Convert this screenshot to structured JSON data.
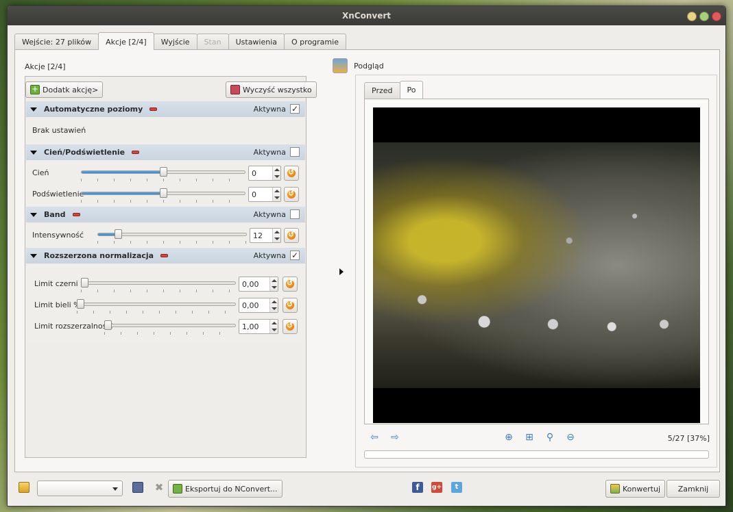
{
  "window": {
    "title": "XnConvert"
  },
  "tabs": [
    {
      "label": "Wejście: 27 plików",
      "state": "normal"
    },
    {
      "label": "Akcje [2/4]",
      "state": "active"
    },
    {
      "label": "Wyjście",
      "state": "normal"
    },
    {
      "label": "Stan",
      "state": "disabled"
    },
    {
      "label": "Ustawienia",
      "state": "normal"
    },
    {
      "label": "O programie",
      "state": "normal"
    }
  ],
  "actions_panel": {
    "title": "Akcje [2/4]",
    "add_button": "Dodatk akcję>",
    "clear_button": "Wyczyść wszystko",
    "active_label": "Aktywna",
    "actions": [
      {
        "name": "Automatyczne poziomy",
        "active": true,
        "empty_text": "Brak ustawień"
      },
      {
        "name": "Cień/Podświetlenie",
        "active": false,
        "params": [
          {
            "label": "Cień",
            "value": "0",
            "fraction": 0.5
          },
          {
            "label": "Podświetlenie",
            "value": "0",
            "fraction": 0.5
          }
        ]
      },
      {
        "name": "Band",
        "active": false,
        "params": [
          {
            "label": "Intensywność",
            "value": "12",
            "fraction": 0.12
          }
        ]
      },
      {
        "name": "Rozszerzona normalizacja",
        "active": true,
        "params": [
          {
            "label": "Limit czerni %",
            "value": "0,00",
            "fraction": 0.0
          },
          {
            "label": "Limit bieli %",
            "value": "0,00",
            "fraction": 0.0
          },
          {
            "label": "Limit rozszerzalności",
            "value": "1,00",
            "fraction": 0.0
          }
        ]
      }
    ]
  },
  "preview": {
    "title": "Podgląd",
    "tabs": [
      {
        "label": "Przed"
      },
      {
        "label": "Po",
        "state": "active"
      }
    ],
    "status": "5/27 [37%]",
    "nav_icons": [
      "arrow-left-icon",
      "arrow-right-icon",
      "zoom-in-icon",
      "fit-icon",
      "zoom-icon",
      "zoom-out-icon"
    ]
  },
  "bottom": {
    "export_button": "Eksportuj do NConvert...",
    "convert_button": "Konwertuj",
    "close_button": "Zamknij"
  },
  "colors": {
    "accent": "#3a86cc",
    "header_bg": "#cfd9e3",
    "reset": "#f08a10"
  }
}
